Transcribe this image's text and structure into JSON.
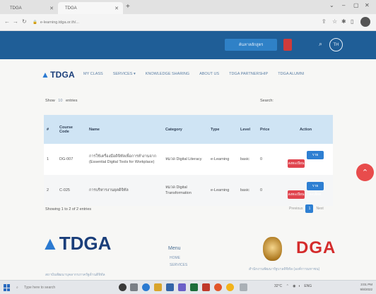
{
  "browser": {
    "tabs": [
      "TDGA",
      "TDGA"
    ],
    "url": "e-learning.tdga.or.th/..."
  },
  "header": {
    "search_pill": "ค้นหาหลักสูตร",
    "lang_button": "TH"
  },
  "site": {
    "logo": "TDGA",
    "nav": [
      "MY CLASS",
      "SERVICES ▾",
      "KNOWLEDGE SHARING",
      "ABOUT US",
      "TDGA PARTNERSHIP",
      "TDGA ALUMNI"
    ]
  },
  "table": {
    "show_prefix": "Show",
    "show_value": "10",
    "show_suffix": "entries",
    "search_label": "Search:",
    "columns": [
      "#",
      "Course Code",
      "Name",
      "Category",
      "Type",
      "Level",
      "Price",
      "Action"
    ],
    "rows": [
      {
        "num": "1",
        "code": "DG-007",
        "name": "การใช้เครื่องมือดิจิทัลเพื่อการทำงานจาก (Essential Digital Tools for Workplace)",
        "category": "หมวด Digital Literacy",
        "type": "e-Learning",
        "level": "basic",
        "price": "0",
        "btn_a": "ลงทะเบียน",
        "btn_b": "รายละเอียด"
      },
      {
        "num": "2",
        "code": "C-025",
        "name": "การบริหารงานยุคดิจิทัล",
        "category": "หมวด Digital Transformation",
        "type": "e-Learning",
        "level": "basic",
        "price": "0",
        "btn_a": "ลงทะเบียน",
        "btn_b": "รายละเอียด"
      }
    ],
    "info": "Showing 1 to 2 of 2 entries",
    "pager": {
      "prev": "Previous",
      "current": "1",
      "next": "Next"
    }
  },
  "footer": {
    "logo": "TDGA",
    "menu_heading": "Menu",
    "menu_items": [
      "HOME",
      "SERVICES"
    ],
    "org_logo": "DGA",
    "left_text": "สถาบันพัฒนาบุคลากรภาครัฐด้านดิจิทัล",
    "right_text": "สำนักงานพัฒนารัฐบาลดิจิทัล (องค์การมหาชน)"
  },
  "taskbar": {
    "search_placeholder": "Type here to search",
    "weather": "32°C",
    "lang": "ENG",
    "time": "3:01 PM",
    "date": "9/8/2022"
  },
  "colors": {
    "header_band": "#1f5e97",
    "accent_blue": "#2e7fd2",
    "accent_red": "#e0444e",
    "table_header": "#cfe4f4"
  }
}
